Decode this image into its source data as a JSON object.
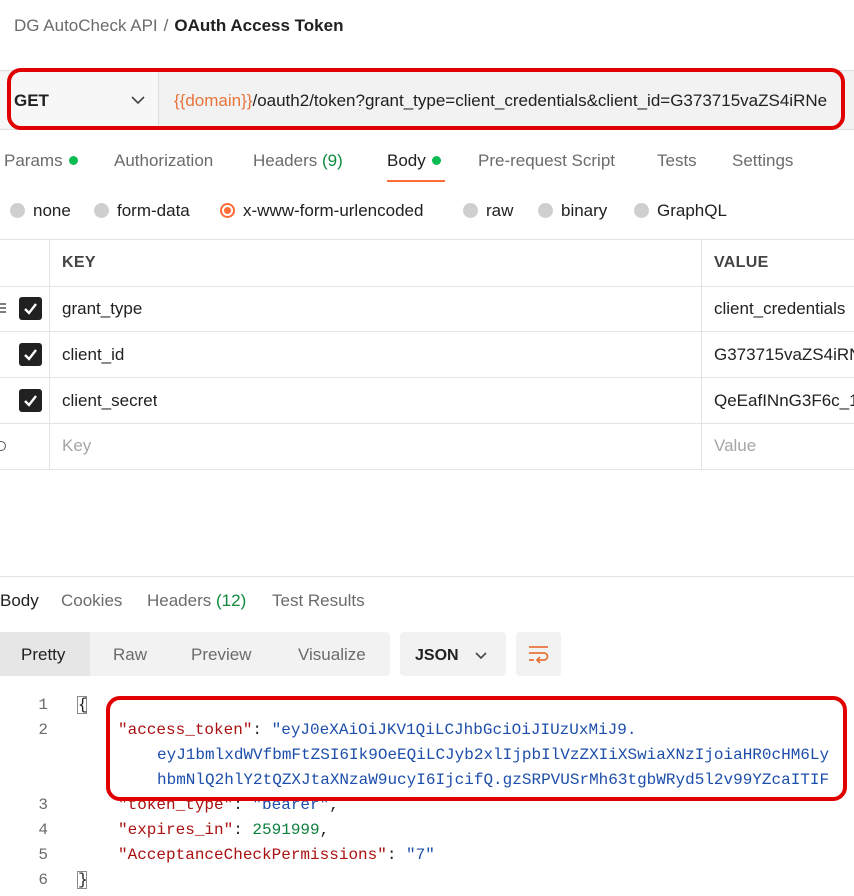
{
  "breadcrumb": {
    "parent": "DG AutoCheck API",
    "separator": "/",
    "current": "OAuth Access Token"
  },
  "request": {
    "method": "GET",
    "url_variable": "{{domain}}",
    "url_rest": "/oauth2/token?grant_type=client_credentials&client_id=G373715vaZS4iRNe"
  },
  "request_tabs": {
    "params": "Params",
    "authorization": "Authorization",
    "headers": "Headers",
    "headers_count": "(9)",
    "body": "Body",
    "pre_request": "Pre-request Script",
    "tests": "Tests",
    "settings": "Settings"
  },
  "body_types": {
    "none": "none",
    "form_data": "form-data",
    "urlencoded": "x-www-form-urlencoded",
    "raw": "raw",
    "binary": "binary",
    "graphql": "GraphQL",
    "selected": "x-www-form-urlencoded"
  },
  "table": {
    "headers": {
      "key": "KEY",
      "value": "VALUE"
    },
    "rows": [
      {
        "key": "grant_type",
        "value": "client_credentials",
        "checked": true
      },
      {
        "key": "client_id",
        "value": "G373715vaZS4iRN",
        "checked": true
      },
      {
        "key": "client_secret",
        "value": "QeEafINnG3F6c_1",
        "checked": true
      }
    ],
    "placeholder": {
      "key": "Key",
      "value": "Value"
    }
  },
  "response_tabs": {
    "body": "Body",
    "cookies": "Cookies",
    "headers": "Headers",
    "headers_count": "(12)",
    "test_results": "Test Results"
  },
  "view_modes": {
    "pretty": "Pretty",
    "raw": "Raw",
    "preview": "Preview",
    "visualize": "Visualize"
  },
  "format": "JSON",
  "code": {
    "line_numbers": [
      "1",
      "2",
      "3",
      "4",
      "5",
      "6"
    ],
    "open_brace": "{",
    "close_brace": "}",
    "access_token_key": "\"access_token\"",
    "access_token_line1": "\"eyJ0eXAiOiJKV1QiLCJhbGciOiJIUzUxMiJ9.",
    "access_token_line2": "eyJ1bmlxdWVfbmFtZSI6Ik9OeEQiLCJyb2xlIjpbIlVzZXIiXSwiaXNzIjoiaHR0cHM6Ly",
    "access_token_line3": "hbmNlQ2hlY2tQZXJtaXNzaW9ucyI6IjcifQ.gzSRPVUSrMh63tgbWRyd5l2v99YZcaITIF",
    "token_type_key": "\"token_type\"",
    "token_type_value": "\"bearer\"",
    "expires_in_key": "\"expires_in\"",
    "expires_in_value": "2591999",
    "permissions_key": "\"AcceptanceCheckPermissions\"",
    "permissions_value": "\"7\""
  },
  "colors": {
    "accent": "#ff6c37",
    "highlight": "#e00000",
    "status_dot": "#0cbb52"
  }
}
